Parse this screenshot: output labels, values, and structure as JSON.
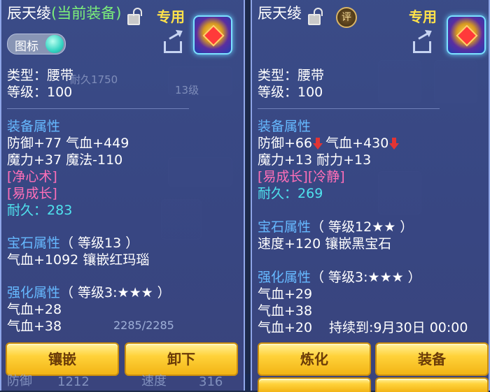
{
  "left": {
    "title": "辰天绫",
    "title_tag": "(当前装备)",
    "special": "专用",
    "toggle_label": "图标",
    "type": "类型：腰带",
    "level": "等级：100",
    "equip_attr_header": "装备属性",
    "attr_line1": "防御+77 气血+449",
    "attr_line2": "魔力+37 魔法-110",
    "skill1": "[净心术]",
    "skill2": "[易成长]",
    "durability_label": "耐久：",
    "durability_value": "283",
    "gem_header": "宝石属性",
    "gem_level": "（ 等级13 ）",
    "gem_line": "气血+1092 镶嵌红玛瑙",
    "enhance_header": "强化属性",
    "enhance_level": "（ 等级3:★★★ ）",
    "enhance_line1": "气血+28",
    "enhance_line2": "气血+38",
    "buttons": {
      "inlay": "镶嵌",
      "unequip": "卸下"
    }
  },
  "right": {
    "title": "辰天绫",
    "rate_badge": "评",
    "special": "专用",
    "type": "类型：腰带",
    "level": "等级：100",
    "equip_attr_header": "装备属性",
    "defense": "防御+66",
    "hp": "气血+430",
    "attr_line2": "魔力+13 耐力+13",
    "skill": "[易成长][冷静]",
    "durability_label": "耐久：",
    "durability_value": "269",
    "gem_header": "宝石属性",
    "gem_level": "（ 等级12★★ ）",
    "gem_line": "速度+120 镶嵌黑宝石",
    "enhance_header": "强化属性",
    "enhance_level": "（ 等级3:★★★ ）",
    "enhance_line1": "气血+29",
    "enhance_line2": "气血+38",
    "enhance_line3": "气血+20",
    "expire": "持续到:9月30日 00:00",
    "buttons": {
      "refine": "炼化",
      "equip": "装备"
    }
  },
  "background": {
    "durability_text": "耐久1750",
    "level_badge": "13级",
    "hp_readout": "2285/2285",
    "stat_defense_label": "防御",
    "stat_defense_value": "1212",
    "stat_speed_label": "速度",
    "stat_speed_value": "316"
  },
  "colors": {
    "panel": "#3c4e8c",
    "section": "#66b9ff",
    "skill": "#ff6fb8",
    "durability": "#4fe3ee",
    "button": "#ffd23a",
    "special": "#ffe24a"
  },
  "icons": {
    "lock": "lock-icon",
    "share": "share-icon",
    "gem": "belt-item-icon",
    "down": "down-arrow-icon"
  }
}
